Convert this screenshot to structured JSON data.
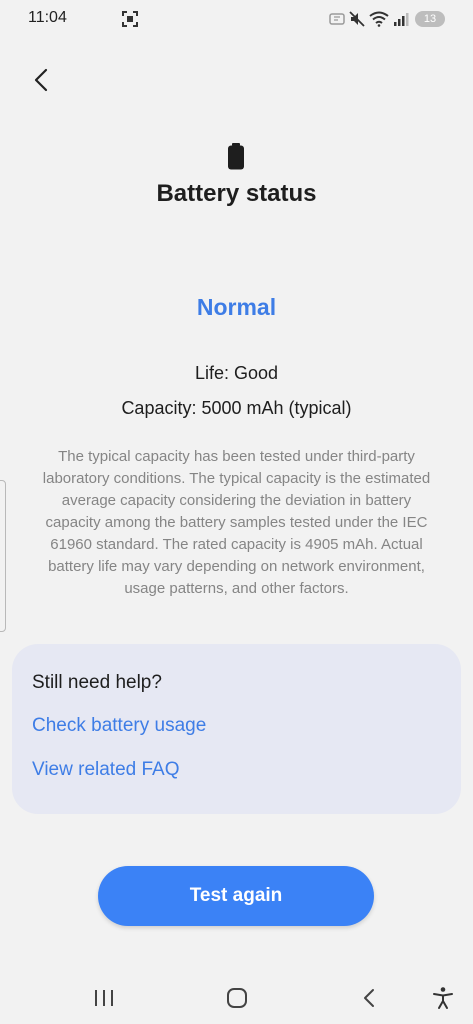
{
  "status_bar": {
    "time": "11:04",
    "notification_count": "13",
    "icons": [
      "screen-recorder-icon",
      "nfc-icon",
      "mute-icon",
      "wifi-icon",
      "signal-icon"
    ]
  },
  "header": {
    "back_icon": "chevron-left-icon",
    "battery_icon": "battery-icon",
    "title": "Battery status"
  },
  "battery": {
    "status": "Normal",
    "status_color": "#3e7de6",
    "life": "Life: Good",
    "capacity": "Capacity: 5000 mAh (typical)",
    "description": "The typical capacity has been tested under third-party laboratory conditions. The typical capacity is the estimated average capacity considering the deviation in battery capacity among the battery samples tested under the IEC 61960 standard. The rated capacity is 4905 mAh. Actual battery life may vary depending on network environment, usage patterns, and other factors."
  },
  "help": {
    "title": "Still need help?",
    "links": [
      "Check battery usage",
      "View related FAQ"
    ]
  },
  "actions": {
    "test_again": "Test again",
    "button_color": "#3b82f6"
  },
  "nav_bar": {
    "icons": [
      "recents-icon",
      "home-icon",
      "back-icon",
      "accessibility-icon"
    ]
  }
}
